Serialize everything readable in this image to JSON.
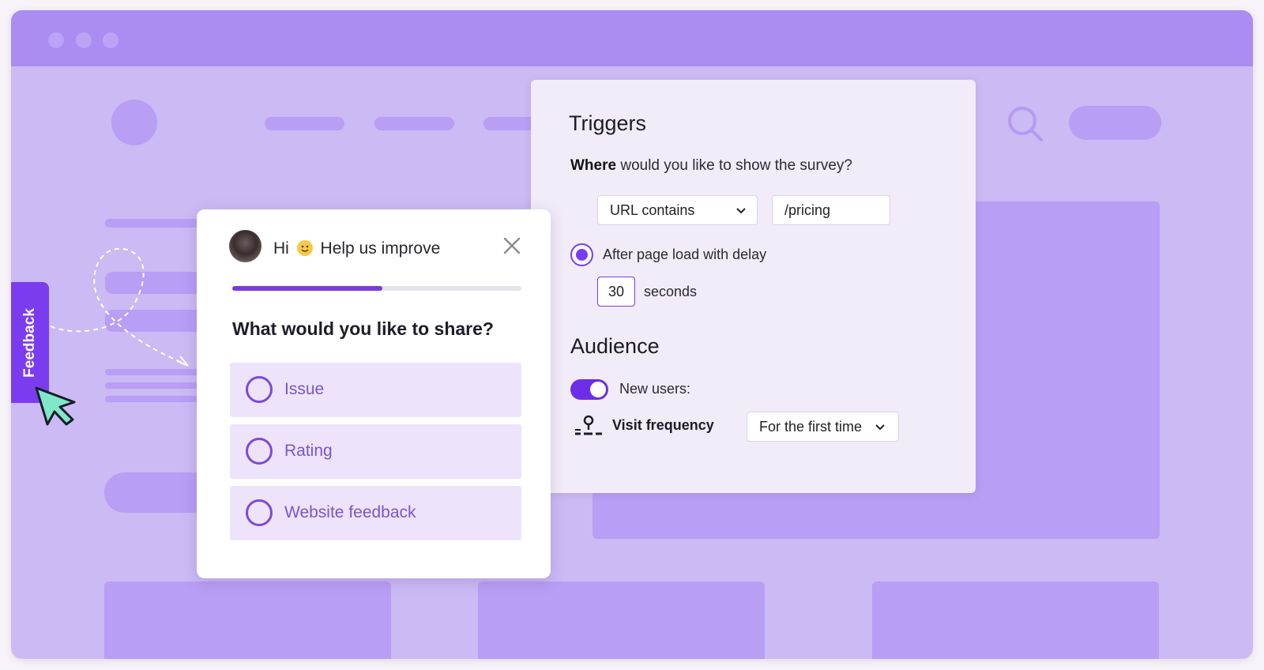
{
  "triggers": {
    "title": "Triggers",
    "where_bold": "Where",
    "where_rest": " would you like to show the survey?",
    "url_condition": "URL contains",
    "url_value": "/pricing",
    "radio_label": "After page load with delay",
    "delay_value": "30",
    "delay_unit": "seconds"
  },
  "audience": {
    "title": "Audience",
    "new_users_label": "New users:",
    "new_users_enabled": true,
    "visit_frequency_label": "Visit frequency",
    "visit_frequency_value": "For the first time"
  },
  "survey": {
    "greeting_pre": "Hi",
    "greeting_post": "Help us improve",
    "progress_fraction": 0.52,
    "question": "What would you like to share?",
    "options": [
      "Issue",
      "Rating",
      "Website feedback"
    ]
  },
  "feedback_tab": {
    "label": "Feedback"
  },
  "colors": {
    "accent": "#7b3cf0",
    "background": "#cbbaf3",
    "titlebar": "#aa8cf2"
  },
  "icons": [
    "search-icon",
    "close-icon",
    "chevron-down-icon",
    "cursor-icon",
    "visit-frequency-icon"
  ]
}
